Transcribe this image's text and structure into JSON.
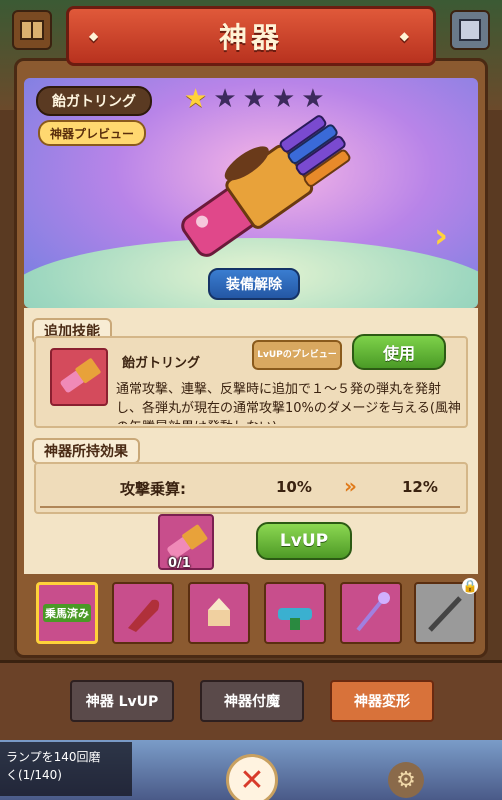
{
  "header": {
    "title": "神器"
  },
  "artifact": {
    "name": "飴ガトリング",
    "preview_badge": "神器プレビュー",
    "stars_filled": 1,
    "stars_total": 5,
    "unequip_label": "装備解除"
  },
  "skill": {
    "section_title": "追加技能",
    "name": "飴ガトリング",
    "preview_button": "LvUPのプレビュー",
    "use_button": "使用",
    "description": "通常攻撃、連撃、反撃時に追加で１～５発の弾丸を発射し、各弾丸が現在の通常攻撃10%のダメージを与える(風神の矢騰晃効果は発動しない)"
  },
  "effect": {
    "section_title": "神器所持効果",
    "label": "攻撃乗算:",
    "current": "10%",
    "next": "12%",
    "material_count": "0/1",
    "lvup_button": "LvUP"
  },
  "slots": [
    {
      "tag": "乗馬済み",
      "color": "#c84e8c",
      "selected": true,
      "locked": false
    },
    {
      "tag": "",
      "color": "#c84e8c",
      "selected": false,
      "locked": false
    },
    {
      "tag": "",
      "color": "#c84e8c",
      "selected": false,
      "locked": false
    },
    {
      "tag": "",
      "color": "#c84e8c",
      "selected": false,
      "locked": false
    },
    {
      "tag": "",
      "color": "#c84e8c",
      "selected": false,
      "locked": false
    },
    {
      "tag": "",
      "color": "#9a9a9a",
      "selected": false,
      "locked": true
    }
  ],
  "tabs": {
    "lvup": "神器 LvUP",
    "enchant": "神器付魔",
    "transform": "神器変形"
  },
  "mission": {
    "line1": "ランプを140回磨",
    "line2": "く(1/140)"
  },
  "colors": {
    "ribbon": "#b8321f",
    "green_button": "#4a9a26",
    "active_tab": "#d8723a",
    "star": "#ffd23a"
  }
}
